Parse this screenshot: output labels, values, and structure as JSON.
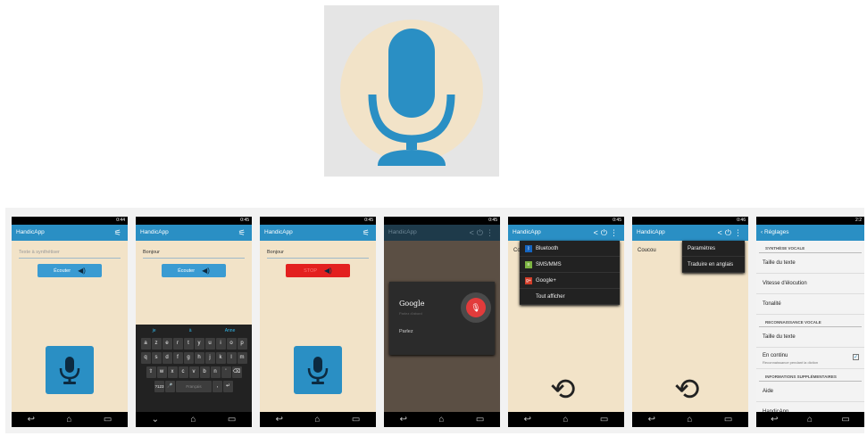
{
  "app": {
    "name": "HandicApp"
  },
  "status": {
    "time_1": "0:44",
    "time_2": "0:45",
    "time_3": "0:45",
    "time_4": "0:45",
    "time_5": "0:45",
    "time_6": "0:46",
    "time_7": "2:2",
    "signal_icon": "signal-battery-icon"
  },
  "screen1": {
    "field_placeholder": "Texte à synthétiser",
    "button_label": "Écouter"
  },
  "screen2": {
    "field_value": "Bonjour",
    "button_label": "Écouter",
    "suggestions": [
      "je",
      "à",
      "Anne"
    ],
    "rows": [
      [
        "a",
        "z",
        "e",
        "r",
        "t",
        "y",
        "u",
        "i",
        "o",
        "p"
      ],
      [
        "q",
        "s",
        "d",
        "f",
        "g",
        "h",
        "j",
        "k",
        "l",
        "m"
      ],
      [
        "⇧",
        "w",
        "x",
        "c",
        "v",
        "b",
        "n",
        "'",
        "⌫"
      ]
    ],
    "bottom_row": {
      "k1": "?123",
      "k2": "🎤",
      "space": "Français",
      "k4": ",",
      "k5": "↵"
    }
  },
  "screen3": {
    "field_value": "Bonjour",
    "button_label": "STOP"
  },
  "screen4": {
    "brand": "Google",
    "sub": "Parlez d'abord",
    "prompt": "Parlez"
  },
  "screen5": {
    "text_prefix": "Co",
    "share_menu": [
      {
        "label": "Bluetooth",
        "icon": "bluetooth-icon"
      },
      {
        "label": "SMS/MMS",
        "icon": "sms-icon"
      },
      {
        "label": "Google+",
        "icon": "google-plus-icon"
      },
      {
        "label": "Tout afficher",
        "icon": ""
      }
    ]
  },
  "screen6": {
    "text": "Coucou",
    "menu": [
      "Paramètres",
      "Traduire en anglais"
    ]
  },
  "screen7": {
    "back_label": "Réglages",
    "section_1": "SYNTHÈSE VOCALE",
    "item_1": "Taille du texte",
    "item_2": "Vitesse d'élocution",
    "item_3": "Tonalité",
    "section_2": "RECONNAISSANCE VOCALE",
    "item_4": "Taille du texte",
    "item_5": "En continu",
    "item_5_sub": "Reconnaissance pendant la diction",
    "section_3": "INFORMATIONS SUPPLÉMENTAIRES",
    "item_6": "Aide",
    "item_7": "HandicApp"
  },
  "colors": {
    "accent": "#2a8fc4",
    "cream": "#f2e3c8",
    "stop_red": "#e3201f",
    "logo_blue": "#2a8fc4"
  }
}
